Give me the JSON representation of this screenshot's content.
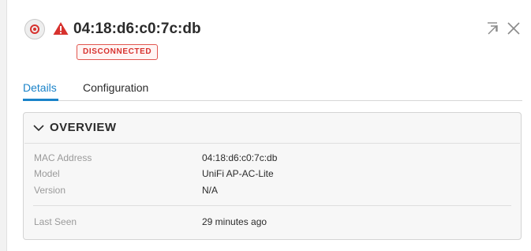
{
  "device": {
    "name": "04:18:d6:c0:7c:db",
    "status": "DISCONNECTED"
  },
  "tabs": [
    {
      "label": "Details",
      "active": true
    },
    {
      "label": "Configuration",
      "active": false
    }
  ],
  "overview": {
    "title": "OVERVIEW",
    "rows": [
      {
        "label": "MAC Address",
        "value": "04:18:d6:c0:7c:db"
      },
      {
        "label": "Model",
        "value": "UniFi AP-AC-Lite"
      },
      {
        "label": "Version",
        "value": "N/A"
      },
      {
        "label": "Last Seen",
        "value": "29 minutes ago"
      }
    ]
  },
  "icons": {
    "locate": "locate-icon",
    "warning": "warning-icon",
    "popout": "popout-icon",
    "close": "close-icon",
    "collapse": "chevron-down-icon"
  },
  "colors": {
    "accent": "#1a83c9",
    "danger": "#d7322e"
  }
}
